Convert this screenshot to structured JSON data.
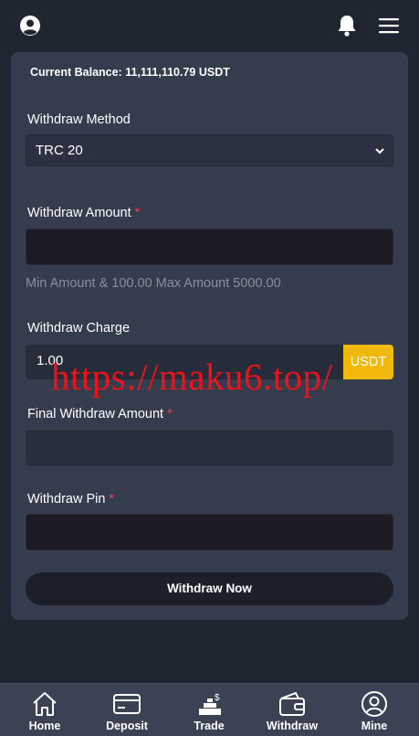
{
  "header": {
    "user_icon": "user-circle-icon",
    "bell_icon": "bell-icon",
    "menu_icon": "hamburger-menu-icon"
  },
  "balance": {
    "text": "Current Balance: 11,111,110.79 USDT"
  },
  "form": {
    "method_label": "Withdraw Method",
    "method_value": "TRC 20",
    "amount_label": "Withdraw Amount",
    "amount_value": "",
    "amount_hint": "Min Amount & 100.00 Max Amount 5000.00",
    "charge_label": "Withdraw Charge",
    "charge_value": "1.00",
    "charge_unit": "USDT",
    "final_label": "Final Withdraw Amount",
    "final_value": "",
    "pin_label": "Withdraw Pin",
    "pin_value": "",
    "required_mark": "*",
    "submit_label": "Withdraw Now"
  },
  "watermark": "https://maku6.top/",
  "nav": {
    "items": [
      {
        "label": "Home",
        "icon": "home-icon"
      },
      {
        "label": "Deposit",
        "icon": "card-icon"
      },
      {
        "label": "Trade",
        "icon": "trade-icon"
      },
      {
        "label": "Withdraw",
        "icon": "wallet-icon"
      },
      {
        "label": "Mine",
        "icon": "user-circle-icon"
      }
    ]
  },
  "colors": {
    "background": "#1f2531",
    "card": "#343c4e",
    "accent": "#f0b90b",
    "required": "#e0454f",
    "watermark": "#e8141c"
  }
}
